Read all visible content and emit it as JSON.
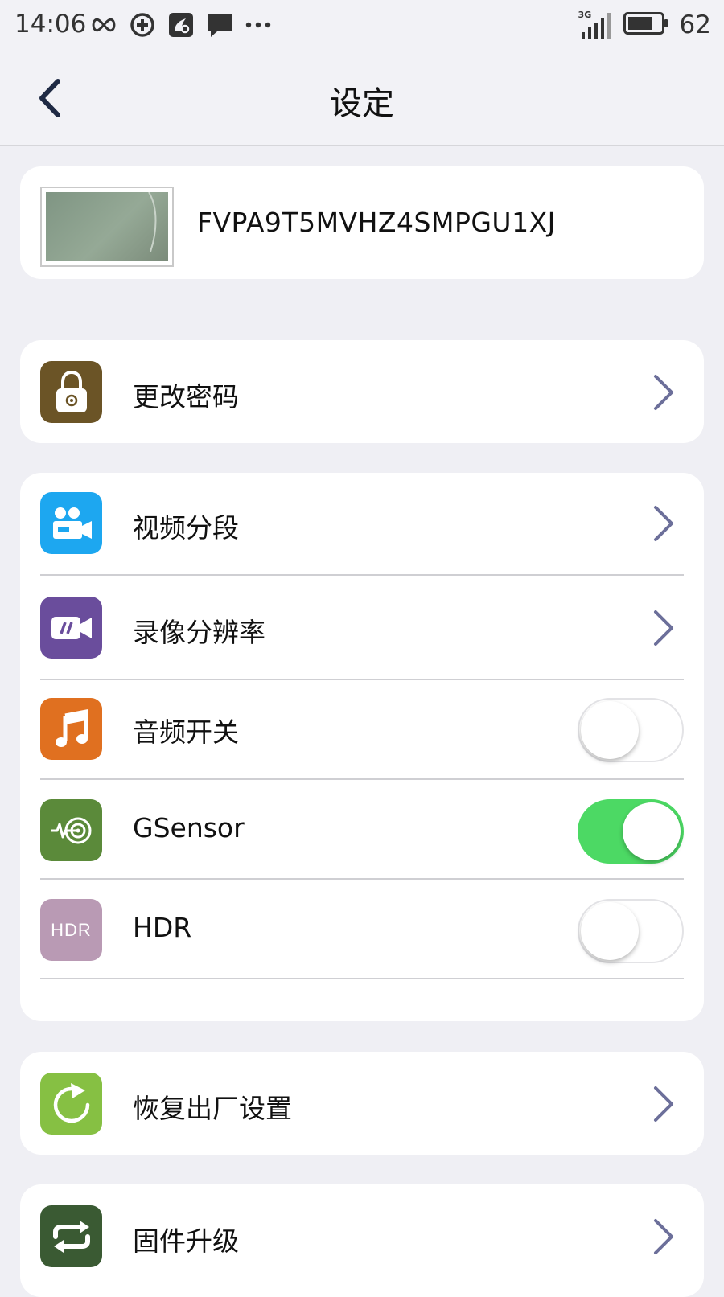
{
  "status_bar": {
    "time": "14:06",
    "network": "3G",
    "battery": "62"
  },
  "nav": {
    "title": "设定"
  },
  "device": {
    "id": "FVPA9T5MVHZ4SMPGU1XJ"
  },
  "settings": {
    "change_password": "更改密码",
    "video_segment": "视频分段",
    "record_resolution": "录像分辨率",
    "audio_switch": "音频开关",
    "gsensor": "GSensor",
    "hdr": "HDR",
    "hdr_icon_text": "HDR",
    "factory_reset": "恢复出厂设置",
    "firmware_upgrade": "固件升级"
  },
  "toggles": {
    "audio_switch": false,
    "gsensor": true,
    "hdr": false
  },
  "colors": {
    "password_icon": "#6b5426",
    "video_segment_icon": "#1da7f0",
    "resolution_icon": "#6a4d9c",
    "audio_icon": "#e07020",
    "gsensor_icon": "#5b8a3a",
    "hdr_icon": "#b99ab4",
    "reset_icon": "#86c043",
    "firmware_icon": "#3a5a33",
    "toggle_on": "#4cd964",
    "chevron": "#6c6f9a"
  }
}
